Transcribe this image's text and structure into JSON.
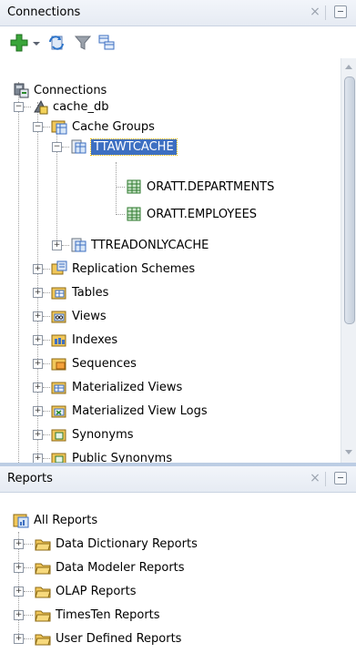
{
  "connections_panel": {
    "title": "Connections",
    "close_glyph": "×",
    "toolbar": {
      "icons": [
        "add-connection-icon",
        "dropdown-arrow-icon",
        "refresh-icon",
        "filter-icon",
        "schema-browser-icon"
      ]
    },
    "tree": [
      {
        "label": "Connections",
        "icon": "connections-icon"
      },
      {
        "label": "cache_db",
        "icon": "database-connection-icon",
        "expanded": true
      },
      {
        "label": "Cache Groups",
        "icon": "cache-groups-icon",
        "expanded": true
      },
      {
        "label": "TTAWTCACHE",
        "icon": "cache-group-icon",
        "expanded": true,
        "selected": true
      },
      {
        "label": "ORATT.DEPARTMENTS",
        "icon": "table-icon"
      },
      {
        "label": "ORATT.EMPLOYEES",
        "icon": "table-icon"
      },
      {
        "label": "TTREADONLYCACHE",
        "icon": "cache-group-icon",
        "expanded": false
      },
      {
        "label": "Replication Schemes",
        "icon": "replication-icon",
        "expanded": false
      },
      {
        "label": "Tables",
        "icon": "tables-folder-icon",
        "expanded": false
      },
      {
        "label": "Views",
        "icon": "views-folder-icon",
        "expanded": false
      },
      {
        "label": "Indexes",
        "icon": "indexes-folder-icon",
        "expanded": false
      },
      {
        "label": "Sequences",
        "icon": "sequences-folder-icon",
        "expanded": false
      },
      {
        "label": "Materialized Views",
        "icon": "mviews-folder-icon",
        "expanded": false
      },
      {
        "label": "Materialized View Logs",
        "icon": "mview-logs-folder-icon",
        "expanded": false
      },
      {
        "label": "Synonyms",
        "icon": "synonyms-folder-icon",
        "expanded": false
      },
      {
        "label": "Public Synonyms",
        "icon": "public-synonyms-folder-icon",
        "expanded": false
      }
    ]
  },
  "reports_panel": {
    "title": "Reports",
    "close_glyph": "×",
    "root": {
      "label": "All Reports",
      "icon": "reports-root-icon"
    },
    "items": [
      {
        "label": "Data Dictionary Reports",
        "icon": "report-folder-icon"
      },
      {
        "label": "Data Modeler Reports",
        "icon": "report-folder-icon"
      },
      {
        "label": "OLAP Reports",
        "icon": "report-folder-icon"
      },
      {
        "label": "TimesTen Reports",
        "icon": "report-folder-icon"
      },
      {
        "label": "User Defined Reports",
        "icon": "report-folder-icon"
      }
    ]
  },
  "colors": {
    "selection": "#3d6fc1",
    "selection_outline": "#e8b800",
    "header_bg": "#e6ebf3",
    "splitter": "#bccde4"
  }
}
